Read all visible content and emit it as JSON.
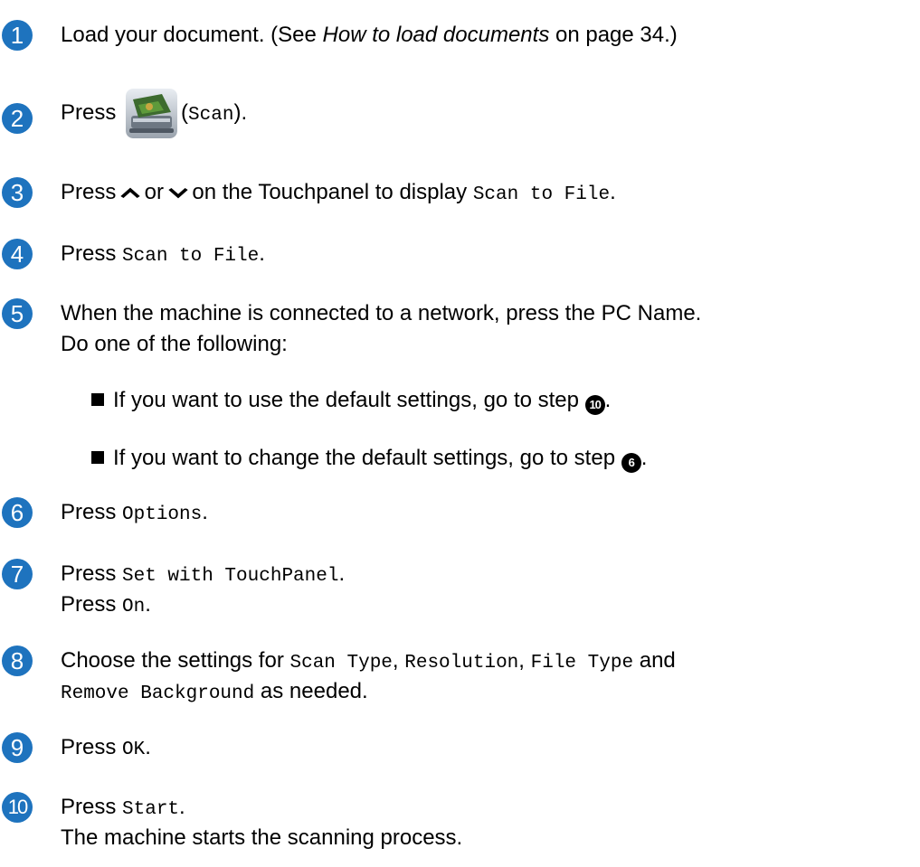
{
  "steps": [
    {
      "num": "1",
      "text_before": "Load your document. (See ",
      "link": "How to load documents",
      "text_after": " on page 34.)"
    },
    {
      "num": "2",
      "prefix": "Press",
      "scan_label": "Scan",
      "suffix": ")."
    },
    {
      "num": "3",
      "t1": "Press ",
      "up": "^",
      "t2": " or ",
      "down": "v",
      "t3": " on the Touchpanel to display ",
      "code": "Scan to File",
      "t4": "."
    },
    {
      "num": "4",
      "t1": "Press ",
      "code": "Scan to File",
      "t2": "."
    },
    {
      "num": "5",
      "line1": "When the machine is connected to a network, press the PC Name.",
      "line2": "Do one of the following:",
      "bullets": [
        {
          "text": "If you want to use the default settings, go to step ",
          "ref": "10",
          "end": "."
        },
        {
          "text": "If you want to change the default settings, go to step ",
          "ref": "6",
          "end": "."
        }
      ]
    },
    {
      "num": "6",
      "t1": "Press ",
      "code": "Options",
      "t2": "."
    },
    {
      "num": "7",
      "t1": "Press ",
      "code": "Set with TouchPanel",
      "t2": ".",
      "t3": "Press ",
      "code2": "On",
      "t4": "."
    },
    {
      "num": "8",
      "t1": "Choose the settings for ",
      "c1": "Scan Type",
      "s1": ", ",
      "c2": "Resolution",
      "s2": ", ",
      "c3": "File Type",
      "s3": " and",
      "c4": "Remove Background",
      "s4": " as needed."
    },
    {
      "num": "9",
      "t1": "Press ",
      "code": "OK",
      "t2": "."
    },
    {
      "num": "10",
      "t1": "Press ",
      "code": "Start",
      "t2": ".",
      "line2": "The machine starts the scanning process."
    }
  ],
  "colors": {
    "step_circle": "#1e73be"
  },
  "icons": {
    "scan": "scanner-icon",
    "up": "chevron-up-icon",
    "down": "chevron-down-icon"
  }
}
